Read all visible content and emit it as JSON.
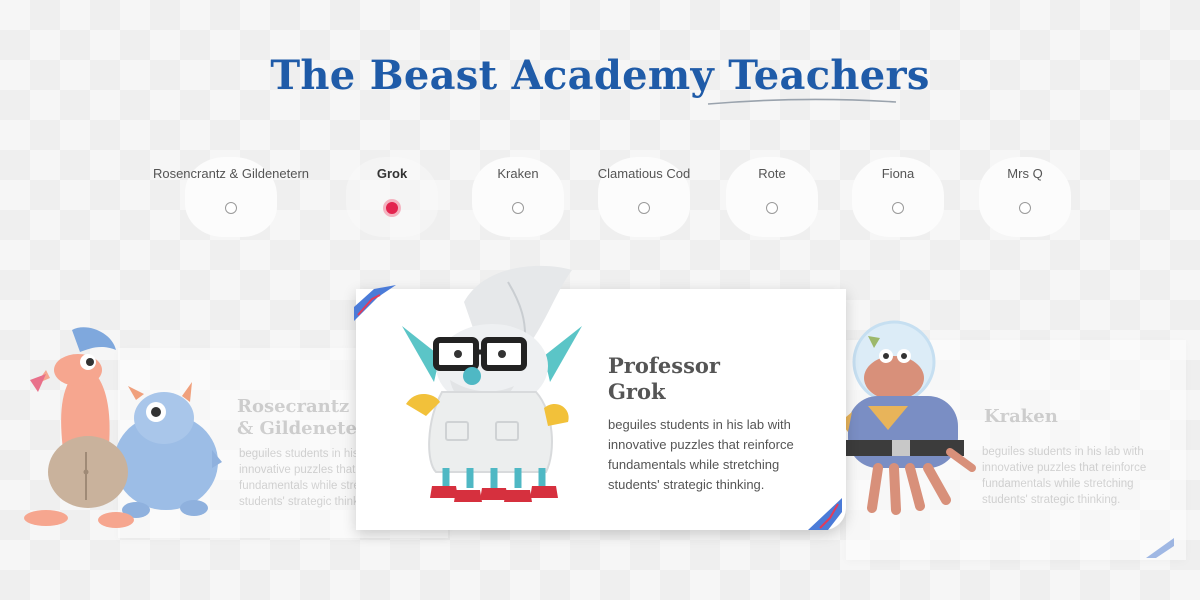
{
  "title": "The Beast Academy Teachers",
  "selector": {
    "items": [
      {
        "label": "Rosencrantz & Gildenetern",
        "selected": false
      },
      {
        "label": "Grok",
        "selected": true
      },
      {
        "label": "Kraken",
        "selected": false
      },
      {
        "label": "Clamatious Cod",
        "selected": false
      },
      {
        "label": "Rote",
        "selected": false
      },
      {
        "label": "Fiona",
        "selected": false
      },
      {
        "label": "Mrs Q",
        "selected": false
      }
    ]
  },
  "cards": {
    "left": {
      "name_line1": "Rosecrantz",
      "name_line2": "& Gildeneter",
      "desc_lines": [
        "beguiles students in his",
        "innovative puzzles that",
        "fundamentals while stre",
        "students' strategic thinki"
      ]
    },
    "main": {
      "name_line1": "Professor",
      "name_line2": "Grok",
      "desc_lines": [
        "beguiles students in his lab with",
        "innovative puzzles that reinforce",
        "fundamentals while stretching",
        "students' strategic thinking."
      ]
    },
    "right": {
      "name": "Kraken",
      "desc_lines": [
        "beguiles students in his lab with",
        "innovative puzzles that reinforce",
        "fundamentals while stretching",
        "students' strategic thinking."
      ]
    }
  },
  "colors": {
    "title": "#1f5ba8",
    "radio_active": "#e3244f",
    "text": "#555555"
  }
}
